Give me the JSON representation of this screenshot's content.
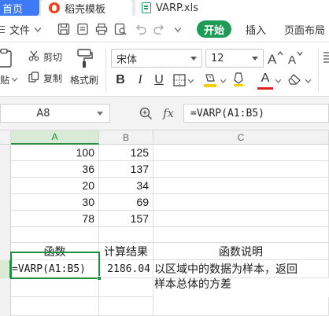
{
  "tabs": {
    "home": "首页",
    "template": "稻壳模板",
    "document": "VARP.xls"
  },
  "menu": {
    "file": "文件",
    "start": "开始",
    "insert": "插入",
    "page_layout": "页面布局"
  },
  "ribbon": {
    "paste": "贴",
    "cut": "剪切",
    "copy": "复制",
    "format_painter": "格式刷",
    "font_name": "宋体",
    "font_size": "12",
    "bold": "B",
    "italic": "I",
    "underline": "U",
    "font_color_letter": "A",
    "highlight_color": "#f5d000",
    "font_color": "#e02020"
  },
  "formula_bar": {
    "name_box": "A8",
    "fx": "fx",
    "formula": "=VARP(A1:B5)"
  },
  "columns": [
    "A",
    "B",
    "C"
  ],
  "rows": [
    {
      "a": "100",
      "b": "125"
    },
    {
      "a": "36",
      "b": "137"
    },
    {
      "a": "20",
      "b": "34"
    },
    {
      "a": "30",
      "b": "69"
    },
    {
      "a": "78",
      "b": "157"
    }
  ],
  "header_row": {
    "a": "函数",
    "b": "计算结果",
    "c": "函数说明"
  },
  "example_row": {
    "a": "=VARP(A1:B5)",
    "b": "2186.04",
    "c_line1": "以区域中的数据为样本，返回",
    "c_line2": "样本总体的方差"
  },
  "accent": "#1e9c57"
}
